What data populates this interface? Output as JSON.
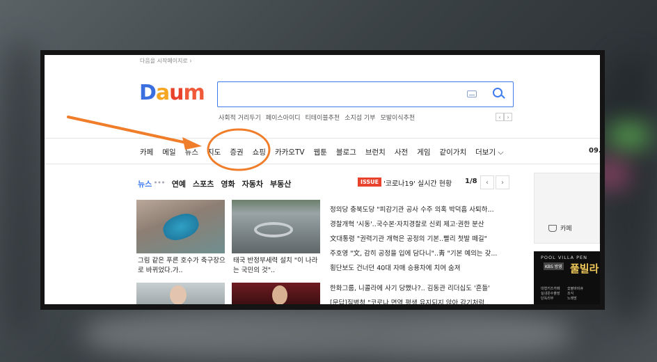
{
  "colors": {
    "accent": "#3d7bf0",
    "annotation": "#f07d2a",
    "issue": "#e8412c"
  },
  "top": {
    "start_link": "다음을 시작페이지로 ›"
  },
  "logo": {
    "d": "D",
    "a": "a",
    "u": "u",
    "m": "m"
  },
  "search": {
    "value": ""
  },
  "keywords": [
    "사회적 거리두기",
    "페이스아이디",
    "티테이블추천",
    "소지섭 기부",
    "모발이식추천"
  ],
  "keyword_nav": {
    "prev": "‹",
    "next": "›"
  },
  "gnb": {
    "items": [
      "카페",
      "메일",
      "뉴스",
      "지도",
      "증권",
      "쇼핑",
      "카카오TV",
      "웹툰",
      "블로그",
      "브런치",
      "사전",
      "게임",
      "같이가치",
      "더보기 ⌵"
    ],
    "date": "09."
  },
  "news_tabs": {
    "items": [
      "뉴스",
      "연예",
      "스포츠",
      "영화",
      "자동차",
      "부동산"
    ],
    "dots": "•••"
  },
  "issue": {
    "badge": "ISSUE",
    "text": "'코로나19' 실시간 현황",
    "page": "1/8",
    "prev": "‹",
    "next": "›"
  },
  "thumb_captions": [
    "그림 같은 푸른 호수가 축구장으로 바뀌었다.가..",
    "태국 반정부세력 설치 \"이 나라는 국민의 것\".."
  ],
  "headlines": [
    "정의당 충북도당 \"피감기관 공사 수주 의혹 박덕흠 사퇴하...",
    "경찰개혁 '시동'..국수본·자치경찰로 신뢰 제고·권한 분산",
    "文대통령 \"권력기관 개혁은 공정의 기본..빨리 첫발 떼길\"",
    "주호영 \"文, 감히 공정을 입에 담다니\"..靑 \"기본 예의는 갖...",
    "횡단보도 건너던 40대 자매 승용차에 치여 숨져"
  ],
  "headlines2": [
    "한화그룹, 니콜라에 사기 당했나?.. 김동관 리더십도 '흔들'",
    "[문답]질병청 \"코로나 면역 평생 유지되지 않아 감기처럼.."
  ],
  "side": {
    "cafe": "카페"
  },
  "ad": {
    "title": "POOL VILLA PEN",
    "badge": "KBS 방영",
    "big": "풀빌라",
    "lines": [
      "대형키즈카페",
      "숯불바비큐",
      "실내온수풀장",
      "조식",
      "단독리무",
      "노래방"
    ]
  }
}
